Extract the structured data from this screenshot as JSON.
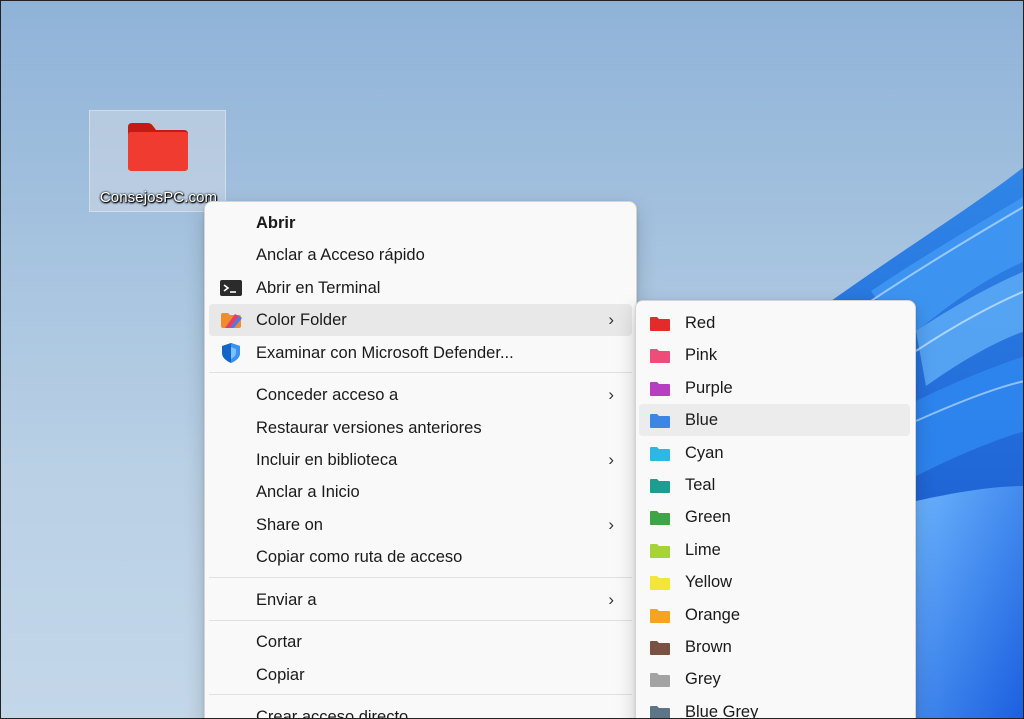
{
  "desktop": {
    "folder_label": "ConsejosPC.com",
    "folder_color": "#e8231d"
  },
  "context_menu": {
    "items": [
      {
        "label": "Abrir",
        "bold": true,
        "icon": "none"
      },
      {
        "label": "Anclar a Acceso rápido",
        "icon": "none"
      },
      {
        "label": "Abrir en Terminal",
        "icon": "terminal-icon"
      },
      {
        "label": "Color Folder",
        "icon": "color-folder-icon",
        "has_submenu": true,
        "highlighted": true
      },
      {
        "label": "Examinar con Microsoft Defender...",
        "icon": "defender-shield-icon"
      },
      {
        "label": "Conceder acceso a",
        "has_submenu": true
      },
      {
        "label": "Restaurar versiones anteriores"
      },
      {
        "label": "Incluir en biblioteca",
        "has_submenu": true
      },
      {
        "label": "Anclar a Inicio"
      },
      {
        "label": "Share on",
        "has_submenu": true
      },
      {
        "label": "Copiar como ruta de acceso"
      },
      {
        "label": "Enviar a",
        "has_submenu": true
      },
      {
        "label": "Cortar"
      },
      {
        "label": "Copiar"
      },
      {
        "label": "Crear acceso directo"
      }
    ],
    "chevron": "›"
  },
  "color_submenu": {
    "items": [
      {
        "label": "Red",
        "color": "#e32b2b"
      },
      {
        "label": "Pink",
        "color": "#ee4d7a"
      },
      {
        "label": "Purple",
        "color": "#b53ec1"
      },
      {
        "label": "Blue",
        "color": "#3d86e6",
        "highlighted": true
      },
      {
        "label": "Cyan",
        "color": "#2fb6e2"
      },
      {
        "label": "Teal",
        "color": "#1f9c92"
      },
      {
        "label": "Green",
        "color": "#3fa447"
      },
      {
        "label": "Lime",
        "color": "#a6d23a"
      },
      {
        "label": "Yellow",
        "color": "#f3e63a"
      },
      {
        "label": "Orange",
        "color": "#f6a320"
      },
      {
        "label": "Brown",
        "color": "#7a5142"
      },
      {
        "label": "Grey",
        "color": "#a3a3a3"
      },
      {
        "label": "Blue Grey",
        "color": "#5d7687"
      }
    ]
  }
}
